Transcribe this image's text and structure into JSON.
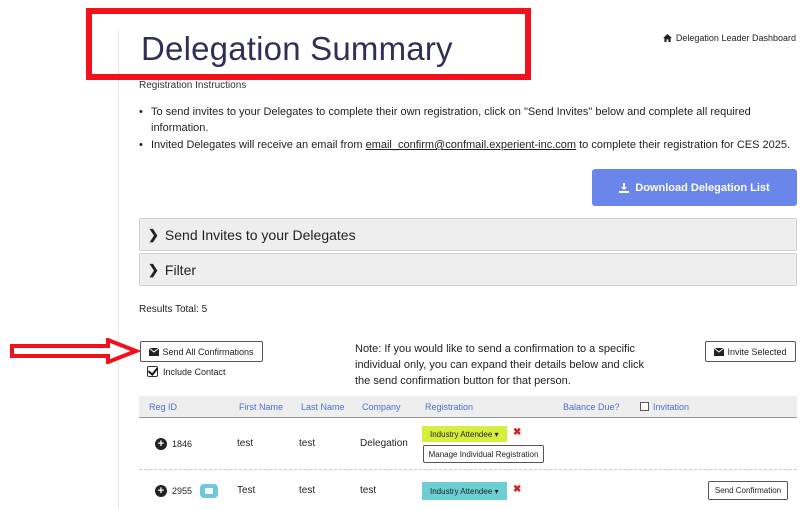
{
  "header": {
    "title": "Delegation Summary",
    "dashboard_link": "Delegation Leader Dashboard"
  },
  "instructions": {
    "title": "Registration Instructions",
    "bullet1": "To send invites to your Delegates to complete their own registration, click on \"Send Invites\" below and complete all required information.",
    "bullet2_pre": "Invited Delegates will receive an email from ",
    "bullet2_email": "email_confirm@confmail.experient-inc.com",
    "bullet2_post": " to complete their registration for CES 2025."
  },
  "download_button": "Download Delegation List",
  "panels": {
    "send_invites": "Send Invites to your Delegates",
    "filter": "Filter"
  },
  "results_total": "Results Total: 5",
  "actions": {
    "send_all": "Send All Confirmations",
    "include_contact": "Include Contact",
    "invite_selected": "Invite Selected",
    "note": "Note: If you would like to send a confirmation to a specific individual only, you can expand their details below and click the send confirmation button for that person."
  },
  "table": {
    "headers": {
      "reg_id": "Reg ID",
      "first_name": "First Name",
      "last_name": "Last Name",
      "company": "Company",
      "registration": "Registration",
      "balance_due": "Balance Due?",
      "invitation": "Invitation"
    },
    "rows": [
      {
        "reg_id": "1846",
        "first_name": "test",
        "last_name": "test",
        "company": "Delegation",
        "registration": "Industry Attendee",
        "manage_label": "Manage Individual Registration"
      },
      {
        "reg_id": "2955",
        "first_name": "Test",
        "last_name": "test",
        "company": "test",
        "registration": "Industry Attendee",
        "send_confirmation": "Send Confirmation"
      }
    ]
  },
  "colors": {
    "title": "#2f2f5a",
    "highlight": "#f2101a",
    "download_button": "#6b86ea",
    "badge_green": "#d6ee3c",
    "badge_teal": "#6ccfd3",
    "header_link": "#4a6fd0"
  },
  "icons": [
    "home-icon",
    "download-icon",
    "chevron-right-icon",
    "envelope-icon",
    "checkbox-checked-icon",
    "plus-circle-icon",
    "remove-icon",
    "arrow-right-annotation"
  ]
}
